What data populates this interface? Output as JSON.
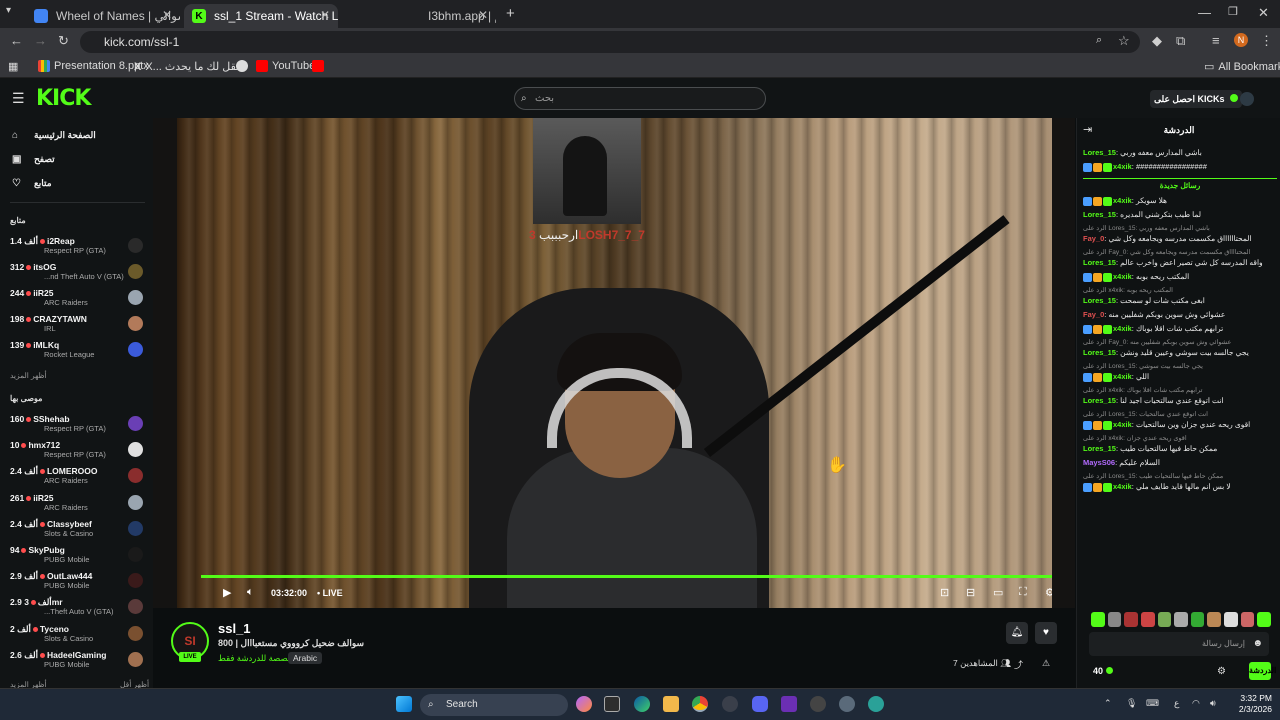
{
  "browser": {
    "tabs": [
      {
        "label": "Wheel of Names | عجلة الأسماء العشوائي",
        "color": "#4285f4"
      },
      {
        "label": "ssl_1 Stream - Watch Live on Kick",
        "color": "#53fc18"
      },
      {
        "label": "I3bhm.app | تخيهم",
        "color": "#888888"
      }
    ],
    "url": "kick.com/ssl-1",
    "profile_initial": "N",
    "bookmarks": {
      "presentation": "Presentation 8.pptx",
      "x_item": "X... ينقل لك ما يحدث",
      "youtube": "YouTube",
      "all": "All Bookmarks"
    }
  },
  "kick": {
    "logo": "KICK",
    "search_placeholder": "بحث",
    "get_kicks": "احصل على KICKs",
    "nav": {
      "home": "الصفحة الرئيسية",
      "browse": "تصفح",
      "following": "متابع"
    },
    "following_header": "متابع",
    "following": [
      {
        "viewers": "1.4 ألف",
        "name": "i2Reap",
        "category": "Respect RP (GTA)",
        "color": "#2a2a2a"
      },
      {
        "viewers": "312",
        "name": "itsOG",
        "category": "...nd Theft Auto V (GTA)",
        "color": "#6b5a2a"
      },
      {
        "viewers": "244",
        "name": "iiR25",
        "category": "ARC Raiders",
        "color": "#9aa5b0"
      },
      {
        "viewers": "198",
        "name": "CRAZYTAWN",
        "category": "IRL",
        "color": "#b27a5a"
      },
      {
        "viewers": "139",
        "name": "iMLKq",
        "category": "Rocket League",
        "color": "#3b5bdb"
      }
    ],
    "show_more": "أظهر المزيد",
    "recommended_header": "موصى بها",
    "recommended": [
      {
        "viewers": "160",
        "name": "SShehab",
        "category": "Respect RP (GTA)",
        "color": "#6a3fb5"
      },
      {
        "viewers": "10",
        "name": "hmx712",
        "category": "Respect RP (GTA)",
        "color": "#e0e0e0"
      },
      {
        "viewers": "2.4 ألف",
        "name": "LOMEROOO",
        "category": "ARC Raiders",
        "color": "#8a2d2d"
      },
      {
        "viewers": "261",
        "name": "iiR25",
        "category": "ARC Raiders",
        "color": "#9aa5b0"
      },
      {
        "viewers": "2.4 ألف",
        "name": "Classybeef",
        "category": "Slots & Casino",
        "color": "#223a66"
      },
      {
        "viewers": "94",
        "name": "SkyPubg",
        "category": "PUBG Mobile",
        "color": "#1a1a1a"
      },
      {
        "viewers": "2.9 ألف",
        "name": "OutLaw444",
        "category": "PUBG Mobile",
        "color": "#3a1a1a"
      },
      {
        "viewers": "2.9 ألف",
        "name": "3mr",
        "category": "...Theft Auto V (GTA)",
        "color": "#5a3a3a"
      },
      {
        "viewers": "2 ألف",
        "name": "Tyceno",
        "category": "Slots & Casino",
        "color": "#7a5030"
      },
      {
        "viewers": "2.6 ألف",
        "name": "HadeelGaming",
        "category": "PUBG Mobile",
        "color": "#a07050"
      }
    ],
    "show_more2": "أظهر المزيد",
    "show_less": "أظهر أقل"
  },
  "player": {
    "overlay_handle": "3LOSH7_7_7",
    "overlay_text": "ارحبببب",
    "time": "03:32:00",
    "live": "LIVE"
  },
  "stream": {
    "avatar_text": "SI",
    "live_badge": "LIVE",
    "channel": "ssl_1",
    "title": "800 | سوالف ضحيل كروووي مستعبااال",
    "category": "مخصصة للدردشة فقط",
    "language": "Arabic",
    "viewers": "7 المشاهدين"
  },
  "chat": {
    "header": "الدردشة",
    "new_messages": "رسائل جديدة",
    "messages_before": [
      {
        "user": "Lores_15",
        "color": "#53fc18",
        "text": "باشي المدارس معفه وربي",
        "reply": "",
        "badges": 0
      },
      {
        "user": "x4xik",
        "color": "#53fc18",
        "text": "#################",
        "reply": "",
        "badges": 3
      }
    ],
    "messages": [
      {
        "user": "x4xik",
        "color": "#53fc18",
        "text": "هلا سويكر",
        "reply": "",
        "badges": 3
      },
      {
        "user": "Lores_15",
        "color": "#53fc18",
        "text": "لما طيب بتكرشني المديره",
        "reply": "",
        "badges": 0
      },
      {
        "user": "Fay_0",
        "color": "#e05050",
        "text": "المحتااااااق مكسمت مدرسه ويجامعه وكل شي",
        "reply": "الرد على Lores_15: باشي المدارس معفه وربي",
        "badges": 0
      },
      {
        "user": "Lores_15",
        "color": "#53fc18",
        "text": "واقه المدرسه كل شي تصير اعض واخرب عالم",
        "reply": "الرد على Fay_0: المحتااااق مكسمت مدرسه ويجامعه وكل شي",
        "badges": 0
      },
      {
        "user": "x4xik",
        "color": "#53fc18",
        "text": "المكتب ريحه بوبه",
        "reply": "",
        "badges": 3
      },
      {
        "user": "Lores_15",
        "color": "#53fc18",
        "text": "ابغى مكتب شات لو سمحت",
        "reply": "الرد على x4xik: المكتب ريحه بوبه",
        "badges": 0
      },
      {
        "user": "Fay_0",
        "color": "#e05050",
        "text": "عشوائي وش سوين بوبكم شفليين منه",
        "reply": "",
        "badges": 0
      },
      {
        "user": "x4xik",
        "color": "#53fc18",
        "text": "ترابهم مكتب شات اقلا بوباك",
        "reply": "",
        "badges": 3
      },
      {
        "user": "Lores_15",
        "color": "#53fc18",
        "text": "يجي جالسه بيت سوشي وعيين قليد ونشن",
        "reply": "الرد على Fay_0: عشوائي وش سوين بوبكم شفليين منه",
        "badges": 0
      },
      {
        "user": "x4xik",
        "color": "#53fc18",
        "text": "اللي",
        "reply": "الرد على Lores_15: يجي جالسه بيت سوشي",
        "badges": 3
      },
      {
        "user": "Lores_15",
        "color": "#53fc18",
        "text": "انت اتوقع عندي سالتحيات اجيد لنا",
        "reply": "الرد على x4xik: ترابهم مكتب شات اقلا بوباك",
        "badges": 0
      },
      {
        "user": "x4xik",
        "color": "#53fc18",
        "text": "اقوى ريحه عندي جزان وين سالتحيات",
        "reply": "الرد على Lores_15: انت اتوقع عندي سالتحيات",
        "badges": 3
      },
      {
        "user": "Lores_15",
        "color": "#53fc18",
        "text": "ممكن حاط فيها سالتحيات طيب",
        "reply": "الرد على x4xik: اقوى ريحه عندي جزان",
        "badges": 0
      },
      {
        "user": "MaysS06",
        "color": "#b36bff",
        "text": "السلام عليكم",
        "reply": "",
        "badges": 0
      },
      {
        "user": "x4xik",
        "color": "#53fc18",
        "text": "لا بس انم مالها قايد طايف ملي",
        "reply": "الرد على Lores_15: ممكن حاط فيها سالتحيات طيب",
        "badges": 3
      }
    ],
    "input_placeholder": "إرسال رسالة",
    "kicks_count": "40",
    "send_label": "الدردشة"
  },
  "taskbar": {
    "search": "Search",
    "time": "3:32 PM",
    "date": "2/3/2026"
  }
}
